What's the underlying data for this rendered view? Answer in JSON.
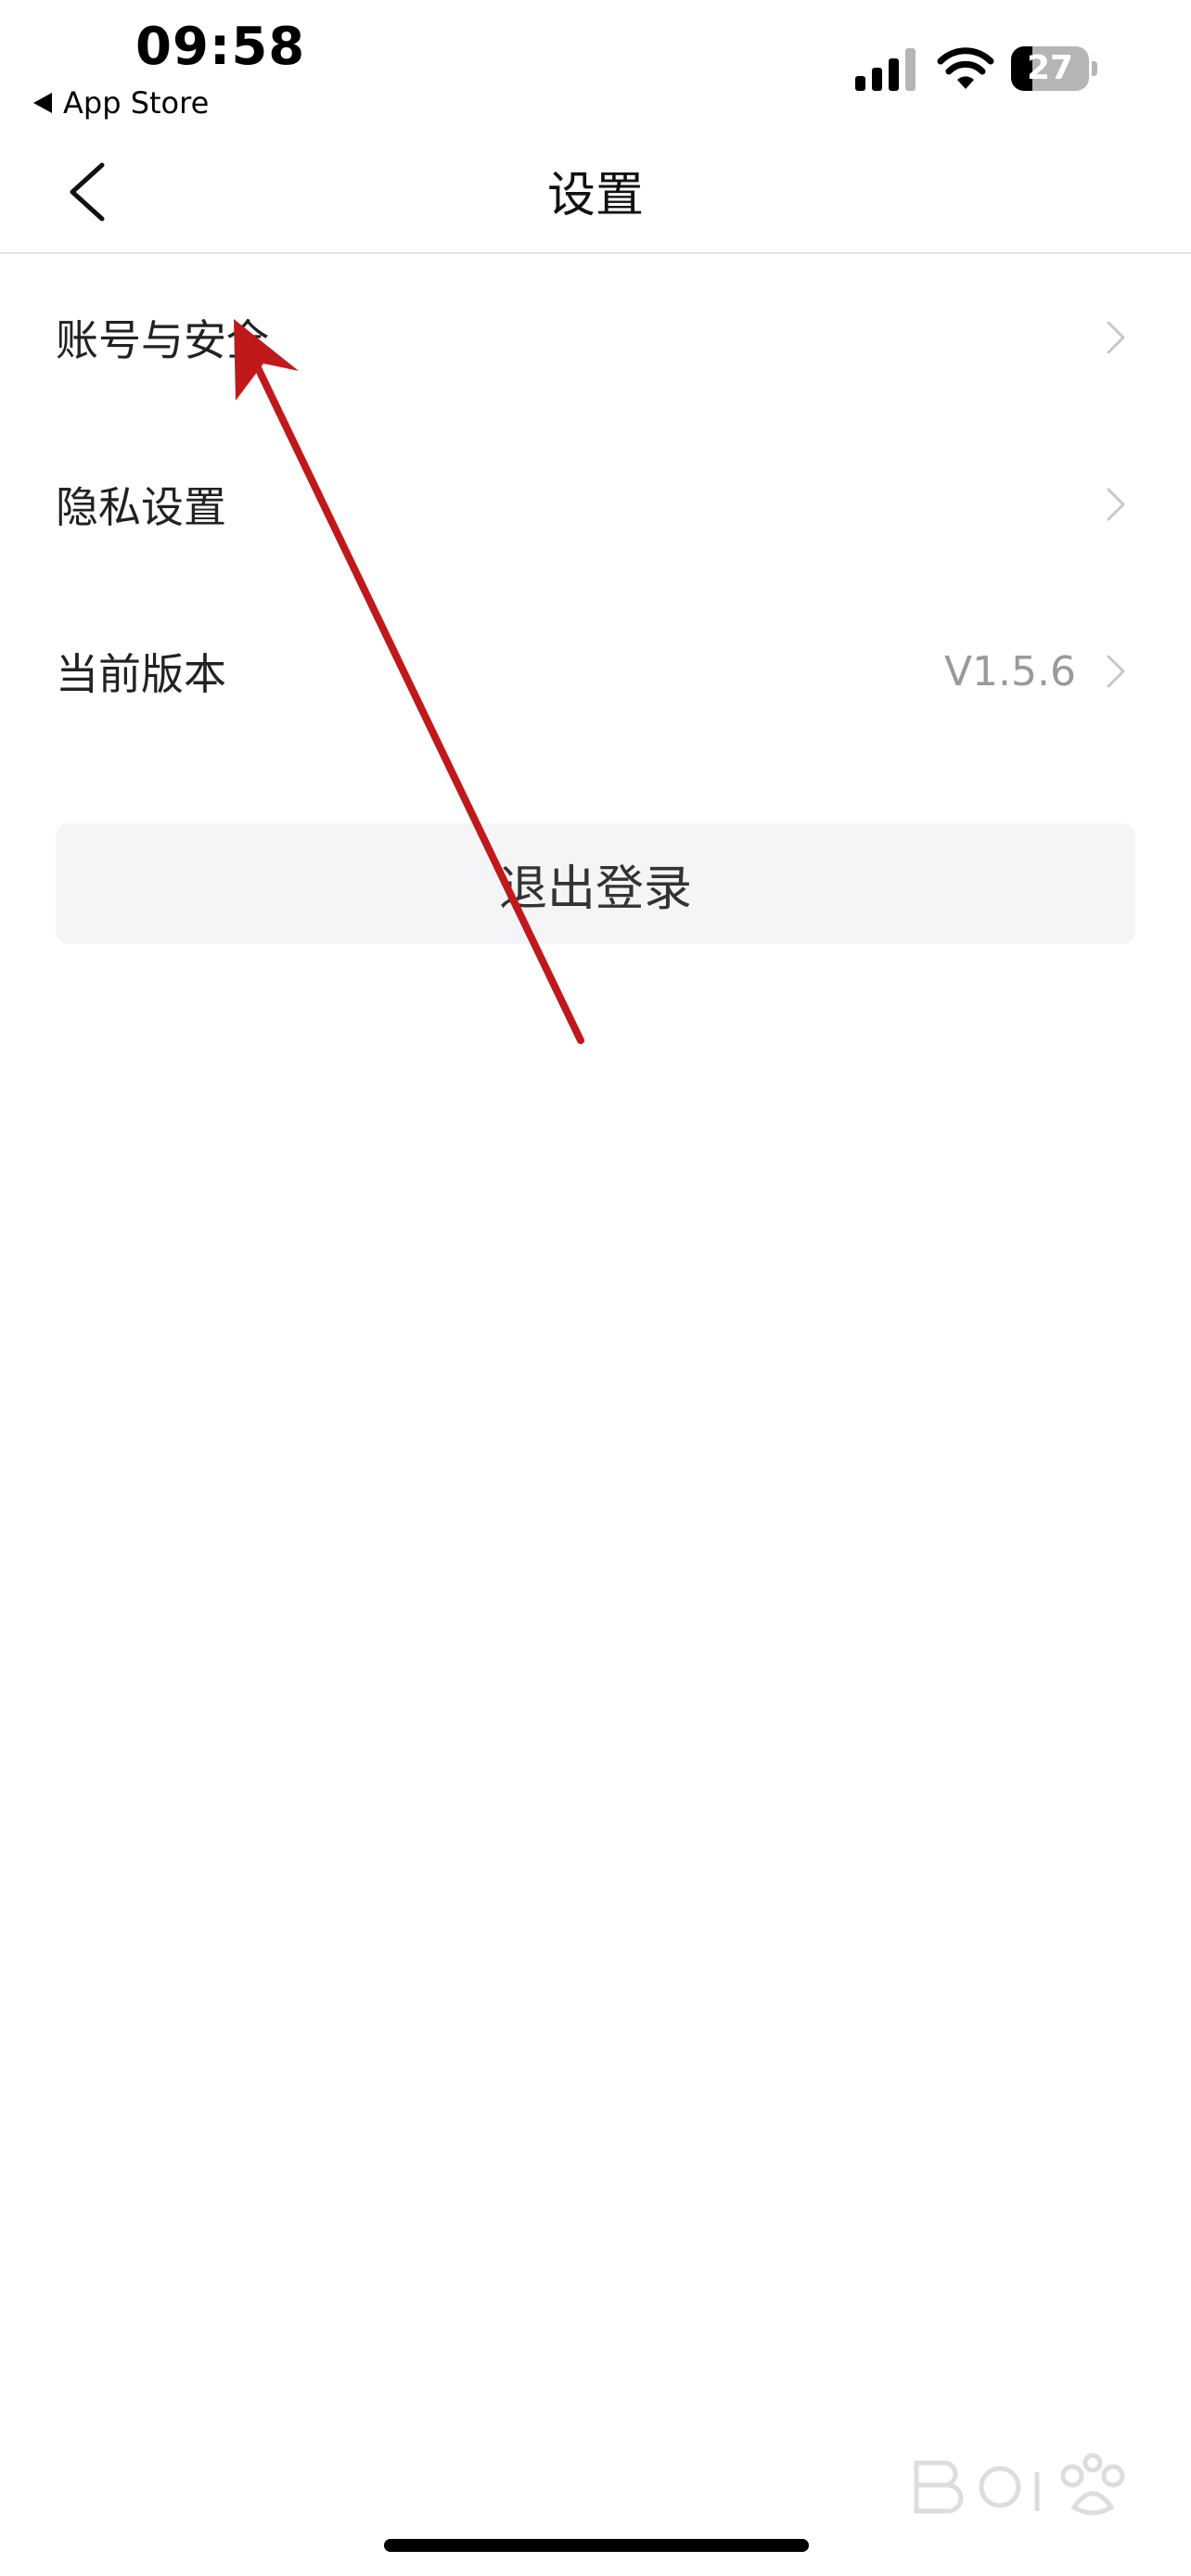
{
  "status_bar": {
    "time": "09:58",
    "back_app": "App Store",
    "battery_level": "27",
    "battery_fraction": 0.27,
    "icons": [
      "signal-icon",
      "wifi-icon",
      "battery-icon"
    ]
  },
  "nav": {
    "title": "设置",
    "back_icon": "chevron-left-icon"
  },
  "settings": {
    "items": [
      {
        "label": "账号与安全",
        "value": ""
      },
      {
        "label": "隐私设置",
        "value": ""
      },
      {
        "label": "当前版本",
        "value": "V1.5.6"
      }
    ]
  },
  "logout": {
    "label": "退出登录"
  },
  "colors": {
    "annotation_arrow": "#c0191b",
    "divider": "#e3e3e3",
    "button_bg": "#f5f5f7",
    "muted_text": "#9a9a9a"
  }
}
